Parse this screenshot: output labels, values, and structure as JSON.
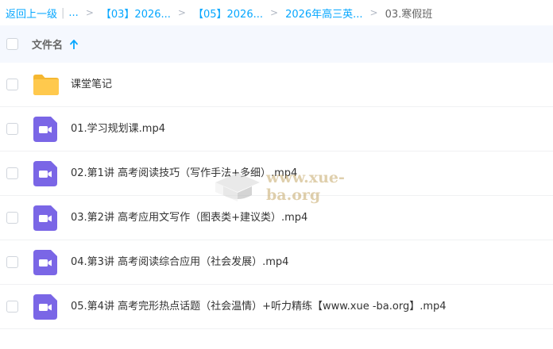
{
  "breadcrumb": {
    "back": "返回上一级",
    "ellipsis": "...",
    "sep": ">",
    "crumbs": [
      "【03】2026...",
      "【05】2026...",
      "2026年高三英..."
    ],
    "current": "03.寒假班"
  },
  "header": {
    "column_name": "文件名",
    "sort_icon": "arrow-up-icon"
  },
  "colors": {
    "accent": "#06a7ff",
    "folder": "#ffc94d",
    "video": "#7a66e6",
    "header_bg": "#f5f8fe"
  },
  "files": [
    {
      "name": "课堂笔记",
      "icon": "folder-icon"
    },
    {
      "name": "01.学习规划课.mp4",
      "icon": "video-icon"
    },
    {
      "name": "02.第1讲 高考阅读技巧（写作手法+多细）.mp4",
      "icon": "video-icon"
    },
    {
      "name": "03.第2讲 高考应用文写作（图表类+建议类）.mp4",
      "icon": "video-icon"
    },
    {
      "name": "04.第3讲 高考阅读综合应用（社会发展）.mp4",
      "icon": "video-icon"
    },
    {
      "name": "05.第4讲 高考完形热点话题（社会温情）+听力精练【www.xue -ba.org】.mp4",
      "icon": "video-icon"
    }
  ],
  "watermark": {
    "text": "www.xue-ba.org"
  }
}
